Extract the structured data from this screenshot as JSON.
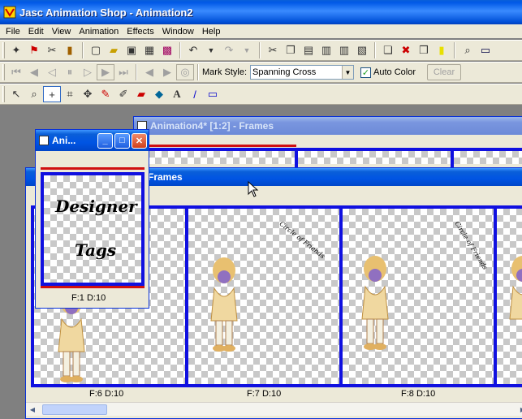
{
  "app": {
    "title": "Jasc Animation Shop - Animation2"
  },
  "menu": [
    "File",
    "Edit",
    "View",
    "Animation",
    "Effects",
    "Window",
    "Help"
  ],
  "toolbar2": {
    "mark_style_label": "Mark Style:",
    "mark_style_value": "Spanning Cross",
    "auto_color_label": "Auto Color",
    "auto_color_checked": true,
    "clear_label": "Clear"
  },
  "win_back": {
    "title": "Animation4* [1:2] - Frames"
  },
  "win_mid": {
    "title": "Frames"
  },
  "win_small": {
    "title": "Ani...",
    "frame_label": "F:1  D:10",
    "preview_text_1": "Designer",
    "preview_text_2": "Tags"
  },
  "frames": [
    {
      "label": "F:6  D:10"
    },
    {
      "label": "F:7  D:10"
    },
    {
      "label": "F:8  D:10"
    }
  ],
  "frame_caption": "Circle of Friends",
  "colors": {
    "frame_border": "#1010e0",
    "red_bar": "#d01010",
    "title_blue": "#0054e3"
  }
}
